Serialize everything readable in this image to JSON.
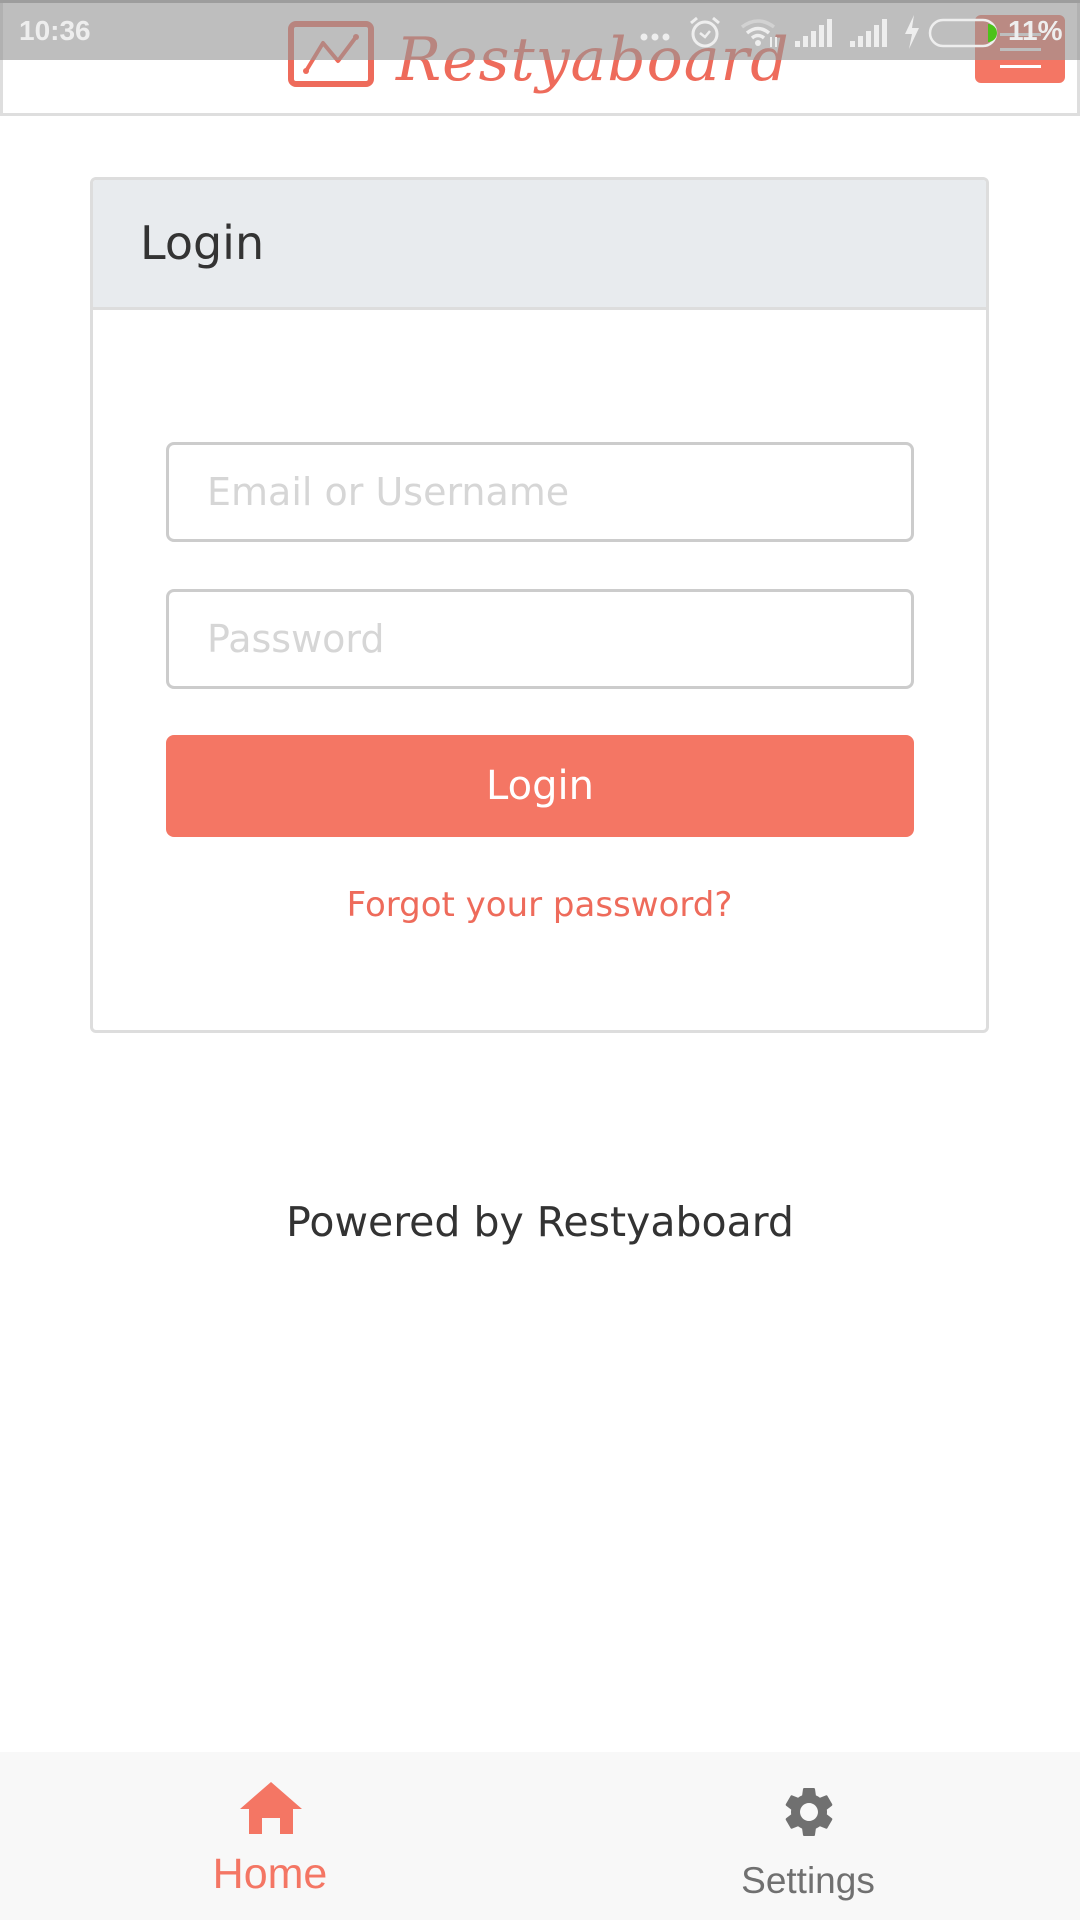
{
  "status_bar": {
    "time": "10:36",
    "icons": [
      "more-dots-icon",
      "alarm-icon",
      "wifi-icon",
      "signal-icon",
      "signal-icon",
      "charging-icon",
      "battery-icon"
    ],
    "battery_percent": "11%",
    "battery_level": 0.11
  },
  "header": {
    "logo_text": "Restyaboard",
    "menu_icon": "hamburger-menu-icon"
  },
  "login_card": {
    "title": "Login",
    "email_placeholder": "Email or Username",
    "email_value": "",
    "password_placeholder": "Password",
    "password_value": "",
    "submit_label": "Login",
    "forgot_link": "Forgot your password?"
  },
  "footer": {
    "powered_by": "Powered by Restyaboard"
  },
  "bottom_nav": {
    "items": [
      {
        "label": "Home",
        "icon": "home-icon",
        "active": true
      },
      {
        "label": "Settings",
        "icon": "gear-icon",
        "active": false
      }
    ]
  },
  "colors": {
    "accent": "#f47664",
    "card_header_bg": "#e8ebee",
    "text": "#333333",
    "inactive_nav": "#707070"
  }
}
